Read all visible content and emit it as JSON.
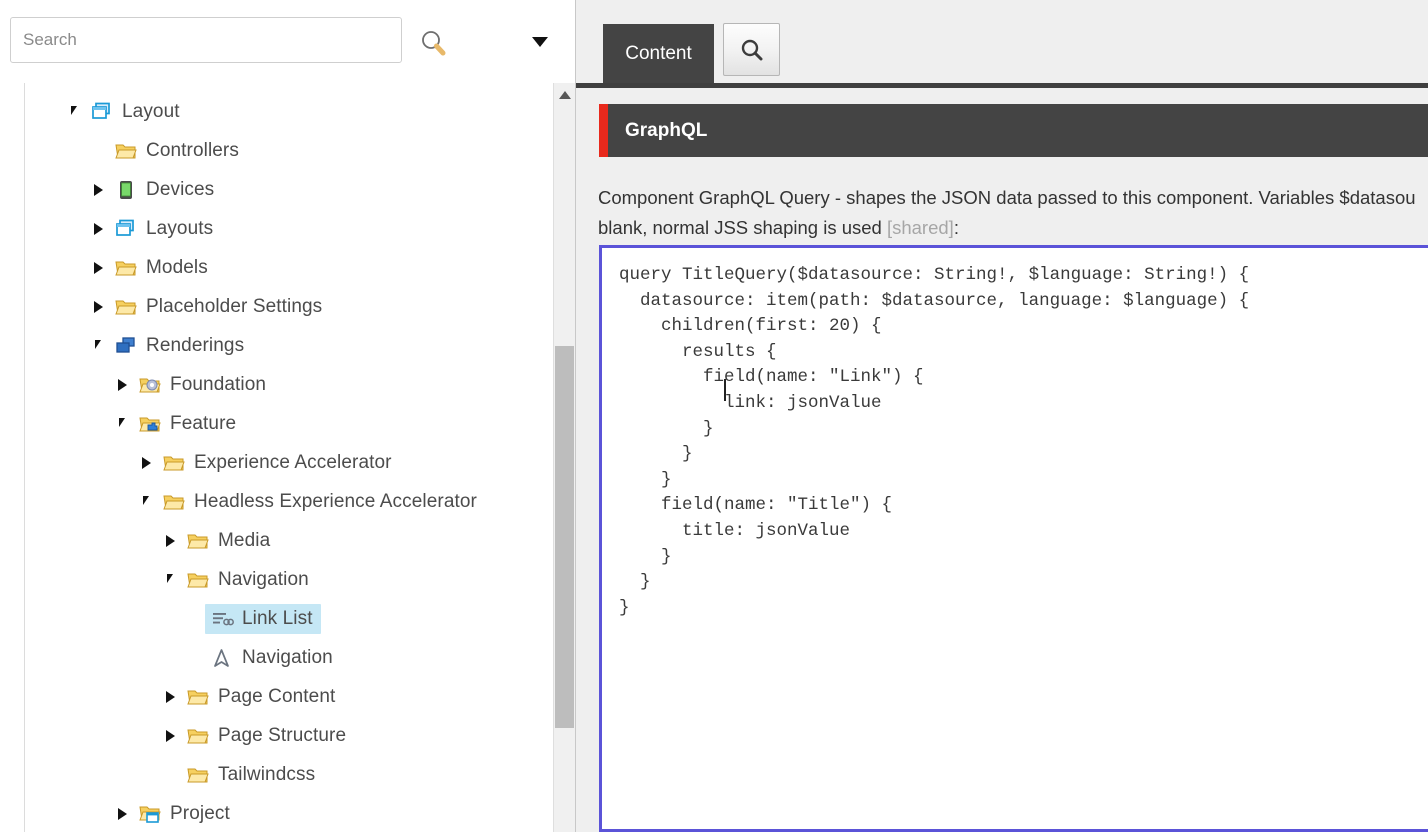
{
  "search": {
    "placeholder": "Search",
    "value": "",
    "magnifier_icon": "search-icon",
    "dropdown_icon": "chevron-down-icon"
  },
  "tree": {
    "scrollbar_up_icon": "scroll-up-arrow-icon",
    "items": [
      {
        "label": "Layout",
        "indent": 0,
        "twisty": "expanded",
        "icon": "layout-stack-icon",
        "state": "root"
      },
      {
        "label": "Controllers",
        "indent": 1,
        "twisty": "none",
        "icon": "folder-icon",
        "state": "normal"
      },
      {
        "label": "Devices",
        "indent": 1,
        "twisty": "collapsed",
        "icon": "device-icon",
        "state": "normal"
      },
      {
        "label": "Layouts",
        "indent": 1,
        "twisty": "collapsed",
        "icon": "layout-stack-icon",
        "state": "normal"
      },
      {
        "label": "Models",
        "indent": 1,
        "twisty": "collapsed",
        "icon": "folder-icon",
        "state": "normal"
      },
      {
        "label": "Placeholder Settings",
        "indent": 1,
        "twisty": "collapsed",
        "icon": "folder-icon",
        "state": "normal"
      },
      {
        "label": "Renderings",
        "indent": 1,
        "twisty": "expanded",
        "icon": "renderings-icon",
        "state": "normal"
      },
      {
        "label": "Foundation",
        "indent": 2,
        "twisty": "collapsed",
        "icon": "folder-gear-icon",
        "state": "normal"
      },
      {
        "label": "Feature",
        "indent": 2,
        "twisty": "expanded",
        "icon": "folder-puzzle-icon",
        "state": "normal"
      },
      {
        "label": "Experience Accelerator",
        "indent": 3,
        "twisty": "collapsed",
        "icon": "folder-icon",
        "state": "normal"
      },
      {
        "label": "Headless Experience Accelerator",
        "indent": 3,
        "twisty": "expanded",
        "icon": "folder-icon",
        "state": "normal"
      },
      {
        "label": "Media",
        "indent": 4,
        "twisty": "collapsed",
        "icon": "folder-icon",
        "state": "normal"
      },
      {
        "label": "Navigation",
        "indent": 4,
        "twisty": "expanded",
        "icon": "folder-icon",
        "state": "normal"
      },
      {
        "label": "Link List",
        "indent": 5,
        "twisty": "none",
        "icon": "link-list-icon",
        "state": "selected"
      },
      {
        "label": "Navigation",
        "indent": 5,
        "twisty": "none",
        "icon": "navigation-a-icon",
        "state": "normal"
      },
      {
        "label": "Page Content",
        "indent": 4,
        "twisty": "collapsed",
        "icon": "folder-icon",
        "state": "normal"
      },
      {
        "label": "Page Structure",
        "indent": 4,
        "twisty": "collapsed",
        "icon": "folder-icon",
        "state": "normal"
      },
      {
        "label": "Tailwindcss",
        "indent": 4,
        "twisty": "none",
        "icon": "folder-icon",
        "state": "normal"
      },
      {
        "label": "Project",
        "indent": 2,
        "twisty": "collapsed",
        "icon": "folder-window-icon",
        "state": "normal"
      }
    ]
  },
  "right": {
    "tabs": [
      {
        "label": "Content",
        "active": true
      }
    ],
    "tab_search_icon": "search-icon",
    "section": {
      "title": "GraphQL",
      "accent_color": "#e8291c"
    },
    "description": {
      "line1": "Component GraphQL Query - shapes the JSON data passed to this component. Variables $datasou",
      "line2_before": "blank, normal JSS shaping is used ",
      "line2_shared": "[shared]",
      "line2_after": ":"
    },
    "editor": {
      "border_color": "#5b53d8",
      "value": "query TitleQuery($datasource: String!, $language: String!) {\n  datasource: item(path: $datasource, language: $language) {\n    children(first: 20) {\n      results {\n        field(name: \"Link\") {\n          link: jsonValue\n        }\n      }\n    }\n    field(name: \"Title\") {\n      title: jsonValue\n    }\n  }\n}"
    }
  }
}
